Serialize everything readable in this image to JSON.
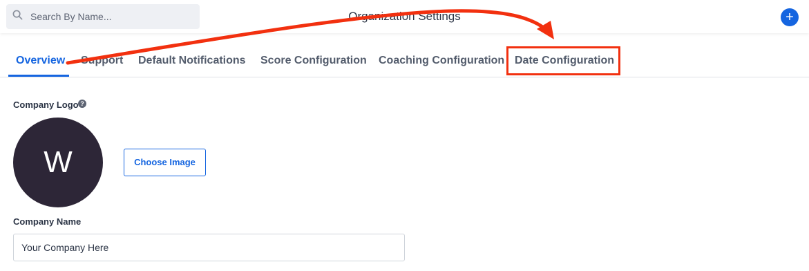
{
  "header": {
    "title": "Organization Settings",
    "add_label": "+"
  },
  "search": {
    "placeholder": "Search By Name...",
    "icon": "search-icon"
  },
  "tabs": [
    {
      "label": "Overview",
      "active": true
    },
    {
      "label": "Support",
      "active": false
    },
    {
      "label": "Default Notifications",
      "active": false
    },
    {
      "label": "Score Configuration",
      "active": false
    },
    {
      "label": "Coaching Configuration",
      "active": false
    },
    {
      "label": "Date Configuration",
      "active": false,
      "highlighted": true
    }
  ],
  "form": {
    "company_logo_label": "Company Logo",
    "help_glyph": "?",
    "logo_letter": "W",
    "choose_image_label": "Choose Image",
    "company_name_label": "Company Name",
    "company_name_value": "Your Company Here"
  },
  "colors": {
    "accent": "#1565e0",
    "annotation": "#f2300f",
    "logo_bg": "#2d2637"
  }
}
